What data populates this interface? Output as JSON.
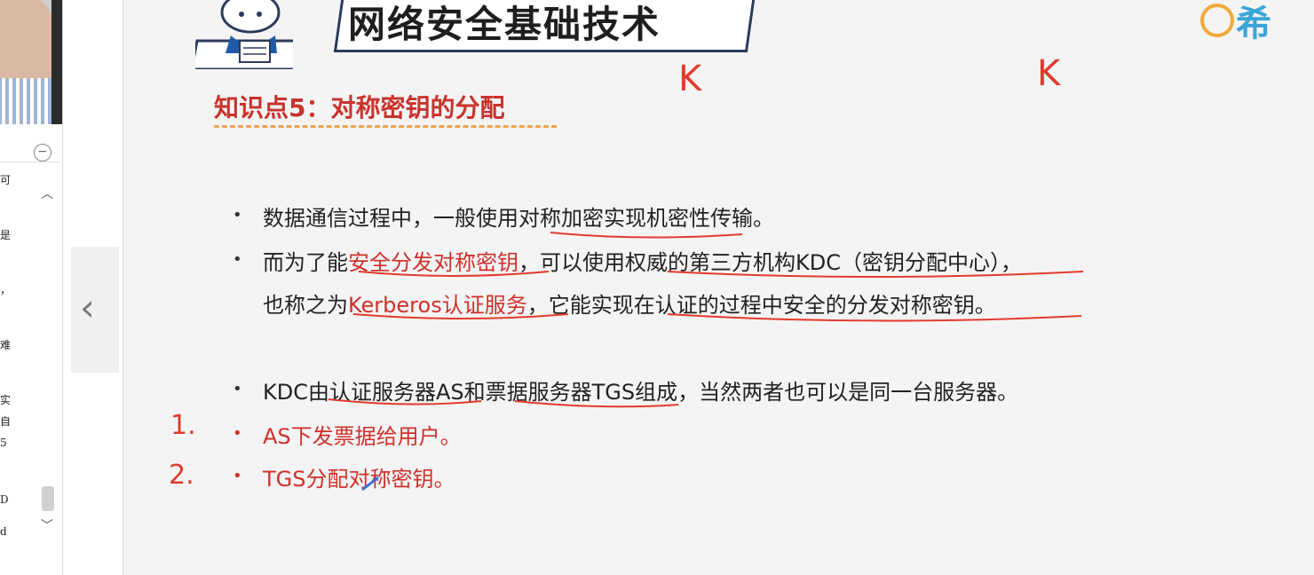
{
  "app": {
    "colors": {
      "accent_red": "#d0302a",
      "pen_red": "#e23a2c",
      "title_underline": "#f2a24a",
      "logo_blue": "#3aa6d8"
    }
  },
  "sidebar": {
    "collapse_icon": "minus-circle-icon",
    "visible_chars": [
      "可",
      "是",
      "，",
      "难",
      "实",
      "自",
      "5",
      "D",
      "d"
    ]
  },
  "navigation": {
    "prev_icon": "chevron-left-icon"
  },
  "slide": {
    "course_title": "网络安全基础技术",
    "logo_text": "希",
    "knowledge_point": "知识点5：对称密钥的分配",
    "lines": {
      "l1_a": "数据通信过程中，一般使用",
      "l1_b": "对称加密实现机密性传输。",
      "l2_a": "而为了能",
      "l2_red": "安全分发对称密钥",
      "l2_b": "，可以使用权威的第三方机构KDC（密钥分配中心），",
      "l3_a": "也称之为",
      "l3_red": "Kerberos认证服务",
      "l3_b": "，它能实现在认证的过程中安全的分发对称密钥。",
      "l4": "KDC由认证服务器AS和票据服务器TGS组成，当然两者也可以是同一台服务器。",
      "l5": "AS下发票据给用户。",
      "l6": "TGS分配对称密钥。"
    },
    "bullet_char": "•"
  },
  "annotations": {
    "k1": "K",
    "k2": "K",
    "num1": "1.",
    "num2": "2."
  }
}
